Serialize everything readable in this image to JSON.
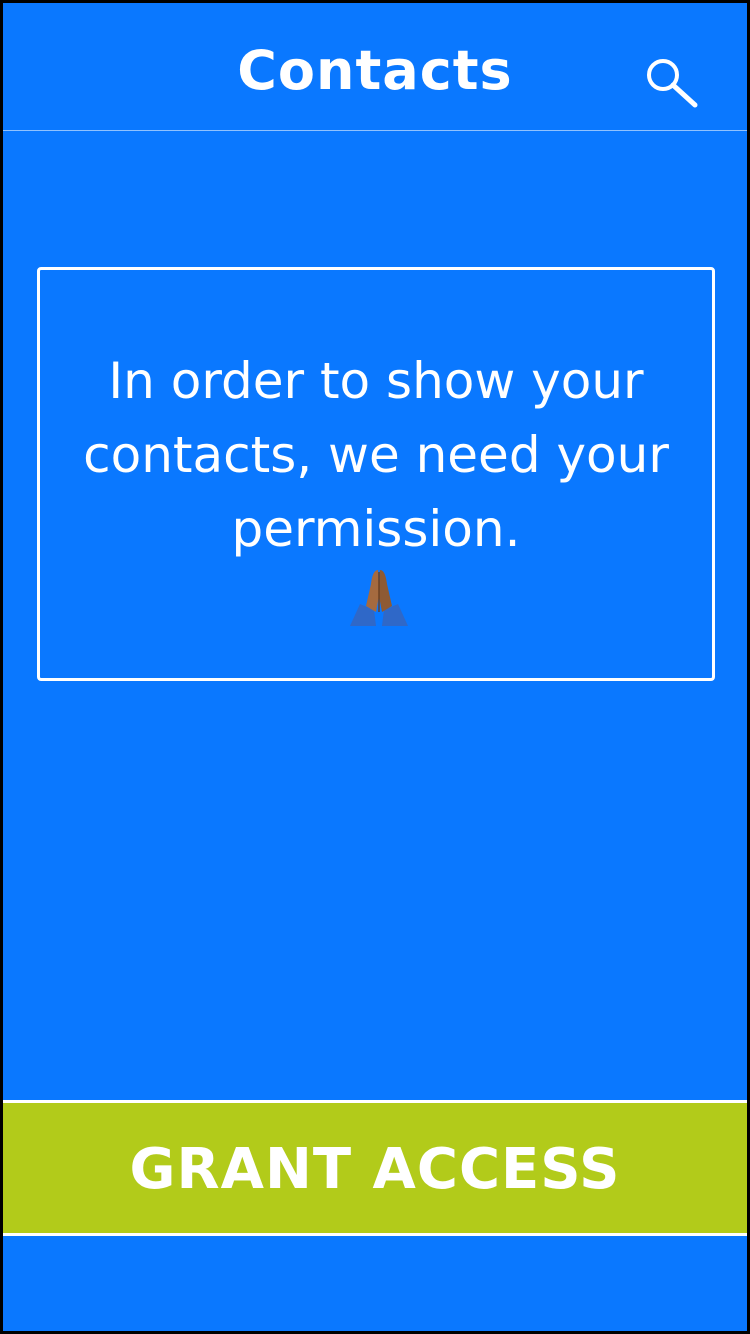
{
  "header": {
    "title": "Contacts",
    "search_icon": "search-icon"
  },
  "permission": {
    "message": "In order to show your contacts, we need your permission.",
    "emoji_icon": "folded-hands-icon"
  },
  "action": {
    "label": "GRANT ACCESS"
  },
  "colors": {
    "background": "#0a78ff",
    "action_bar": "#b2cb1a",
    "text": "#ffffff"
  }
}
